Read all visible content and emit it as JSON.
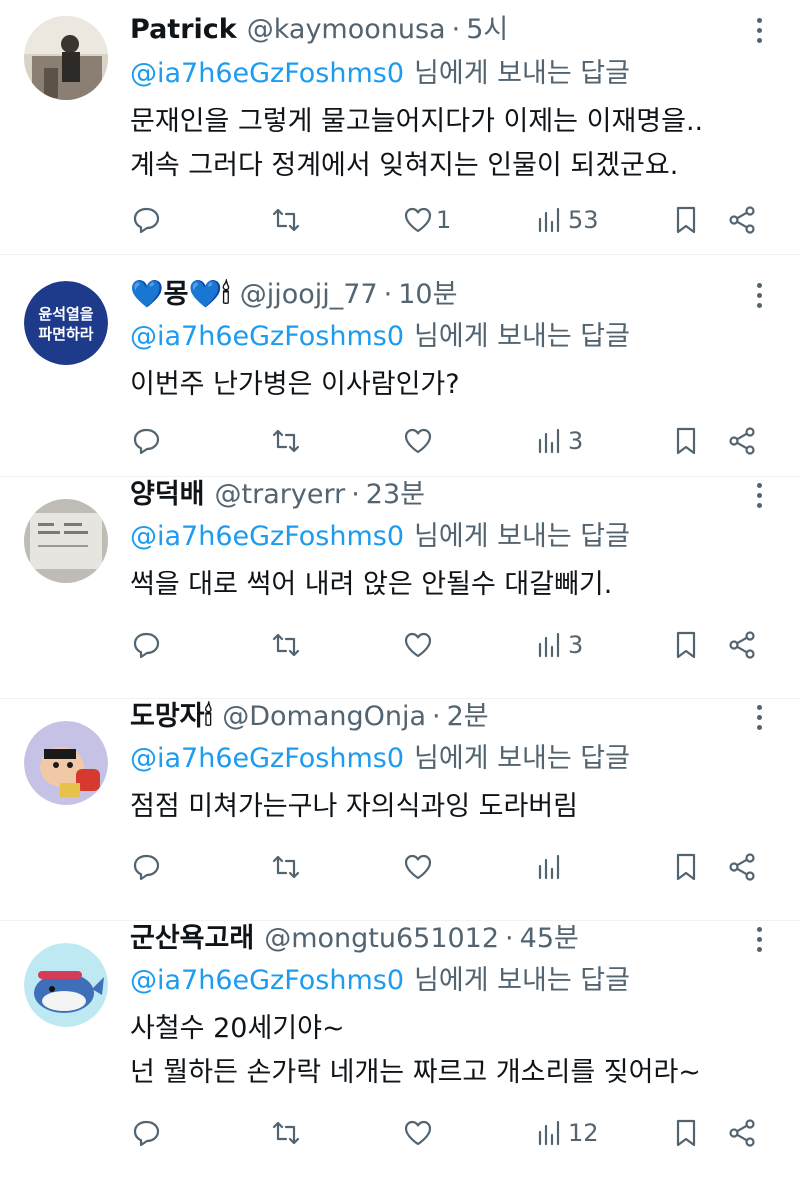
{
  "tweets": [
    {
      "name": "Patrick",
      "handle": "@kaymoonusa",
      "time": "5시",
      "reply_to": "@ia7h6eGzFoshms0",
      "reply_suffix": "님에게 보내는 답글",
      "lines": [
        "문재인을 그렇게 물고늘어지다가 이제는 이재명을..",
        "계속 그러다 정계에서 잊혀지는 인물이 되겠군요."
      ],
      "stats": {
        "replies": "",
        "retweets": "",
        "likes": "1",
        "views": "53"
      }
    },
    {
      "name": "💙몽💙🕯",
      "handle": "@jjoojj_77",
      "time": "10분",
      "reply_to": "@ia7h6eGzFoshms0",
      "reply_suffix": "님에게 보내는 답글",
      "avatar_text": [
        "윤석열을",
        "파면하라"
      ],
      "lines": [
        "이번주 난가병은 이사람인가?"
      ],
      "stats": {
        "replies": "",
        "retweets": "",
        "likes": "",
        "views": "3"
      }
    },
    {
      "name": "양덕배",
      "handle": "@traryerr",
      "time": "23분",
      "reply_to": "@ia7h6eGzFoshms0",
      "reply_suffix": "님에게 보내는 답글",
      "lines": [
        "썩을 대로 썩어 내려 앉은 안될수 대갈빼기."
      ],
      "stats": {
        "replies": "",
        "retweets": "",
        "likes": "",
        "views": "3"
      }
    },
    {
      "name": "도망자🕯",
      "handle": "@DomangOnja",
      "time": "2분",
      "reply_to": "@ia7h6eGzFoshms0",
      "reply_suffix": "님에게 보내는 답글",
      "lines": [
        "점점 미쳐가는구나 자의식과잉 도라버림"
      ],
      "stats": {
        "replies": "",
        "retweets": "",
        "likes": "",
        "views": ""
      }
    },
    {
      "name": "군산욕고래",
      "handle": "@mongtu651012",
      "time": "45분",
      "reply_to": "@ia7h6eGzFoshms0",
      "reply_suffix": "님에게 보내는 답글",
      "lines": [
        "사철수 20세기야~",
        "넌 뭘하든 손가락 네개는 짜르고 개소리를 짖어라~"
      ],
      "stats": {
        "replies": "",
        "retweets": "",
        "likes": "",
        "views": "12"
      }
    }
  ],
  "colors": {
    "mention": "#1d9bf0",
    "secondary": "#536471",
    "text": "#0f1419"
  }
}
